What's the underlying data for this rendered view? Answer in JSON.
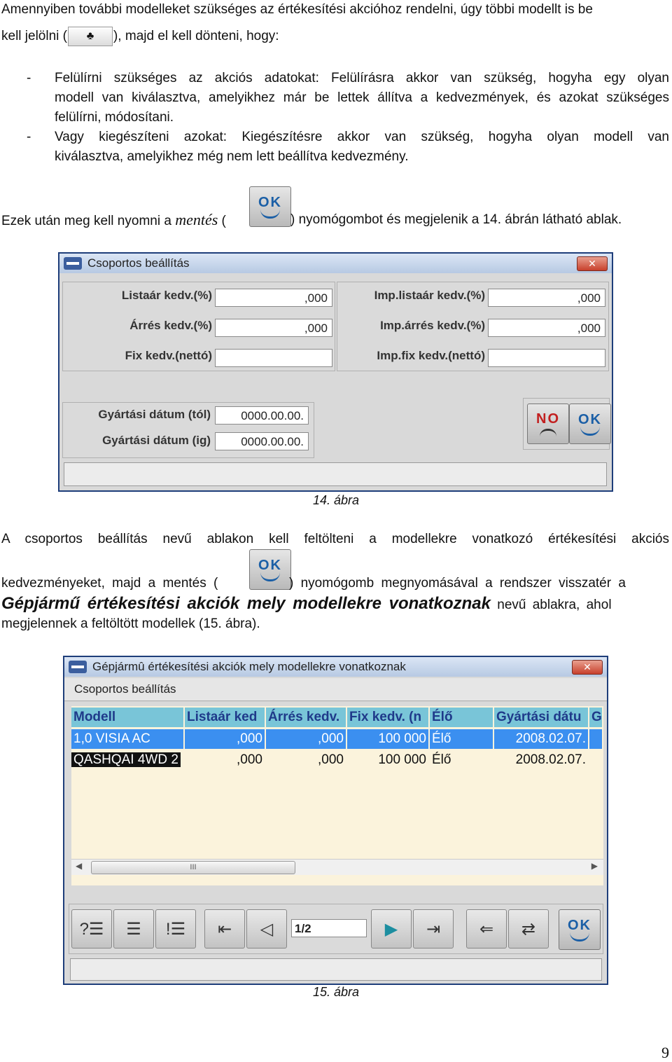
{
  "para1": {
    "line1": "Amennyiben további modelleket szükséges az értékesítési akcióhoz rendelni, úgy többi modellt is be",
    "line2_pre": "kell jelölni (",
    "line2_post": "), majd el kell dönteni, hogy:"
  },
  "bullets": [
    {
      "dash": "-",
      "lines": [
        "Felülírni szükséges az akciós adatokat: Felülírásra akkor van szükség, hogyha egy olyan",
        "modell van kiválasztva, amelyikhez már be lettek állítva a kedvezmények, és azokat szükséges",
        "felülírni, módosítani."
      ]
    },
    {
      "dash": "-",
      "lines": [
        "Vagy kiegészíteni azokat: Kiegészítésre akkor van szükség, hogyha olyan modell van",
        "kiválasztva, amelyikhez még nem lett beállítva kedvezmény."
      ]
    }
  ],
  "para2": {
    "pre": "Ezek után meg kell nyomni a ",
    "mentes": "mentés",
    "open": " (",
    "post": ") nyomógombot és megjelenik a 14. ábrán látható ablak."
  },
  "icons": {
    "club": "club-icon",
    "ok": "ok-button-icon",
    "no": "no-button-icon"
  },
  "ok_label": "OK",
  "no_label": "NO",
  "win1": {
    "title": "Csoportos beállítás",
    "close": "✕",
    "fields_left": [
      {
        "label": "Listaár kedv.(%)",
        "value": ",000"
      },
      {
        "label": "Árrés kedv.(%)",
        "value": ",000"
      },
      {
        "label": "Fix kedv.(nettó)",
        "value": ""
      }
    ],
    "fields_right": [
      {
        "label": "Imp.listaár kedv.(%)",
        "value": ",000"
      },
      {
        "label": "Imp.árrés kedv.(%)",
        "value": ",000"
      },
      {
        "label": "Imp.fix kedv.(nettó)",
        "value": ""
      }
    ],
    "dates": [
      {
        "label": "Gyártási dátum (tól)",
        "value": "0000.00.00."
      },
      {
        "label": "Gyártási dátum (ig)",
        "value": "0000.00.00."
      }
    ]
  },
  "caption14": "14. ábra",
  "para3": {
    "line1": "A csoportos beállítás nevű ablakon kell feltölteni a modellekre vonatkozó értékesítési akciós",
    "line2_pre": "kedvezményeket, majd a mentés (",
    "line2_post": ") nyomógomb megnyomásával a rendszer visszatér a",
    "bold_title": "Gépjármű értékesítési akciók mely modellekre vonatkoznak",
    "line3_post": " nevű ablakra, ahol",
    "line4": "megjelennek a feltöltött modellek (15. ábra)."
  },
  "win2": {
    "title": "Gépjármû értékesítési akciók mely modellekre vonatkoznak",
    "close": "✕",
    "menu": "Csoportos beállítás",
    "columns": [
      "Modell",
      "Listaár ked",
      "Árrés kedv.",
      "Fix kedv. (n",
      "Élő",
      "Gyártási dátu",
      "Gy"
    ],
    "rows": [
      [
        "1,0 VISIA AC",
        ",000",
        ",000",
        "100 000",
        "Élő",
        "2008.02.07.",
        ""
      ],
      [
        "QASHQAI 4WD 2",
        ",000",
        ",000",
        "100 000",
        "Élő",
        "2008.02.07.",
        ""
      ]
    ],
    "scroll_thumb": "III",
    "pager": "1/2"
  },
  "caption15": "15. ábra",
  "page_number": "9"
}
